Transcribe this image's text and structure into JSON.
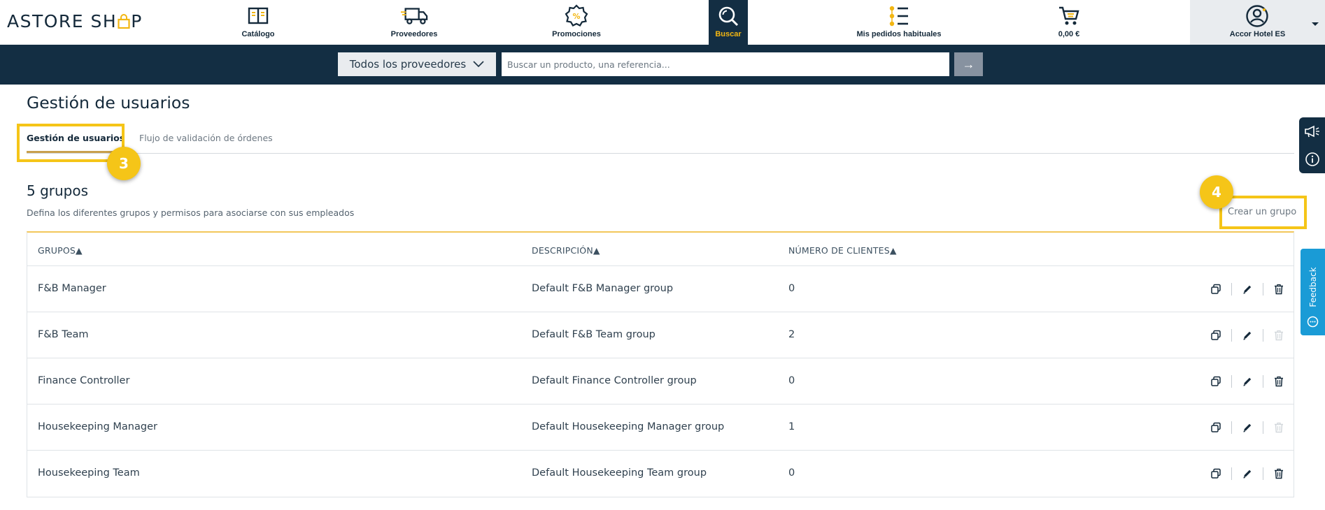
{
  "header": {
    "logo_left": "ASTORE SH",
    "logo_right": "P",
    "nav": [
      {
        "label": "Catálogo",
        "icon": "book-icon"
      },
      {
        "label": "Proveedores",
        "icon": "truck-icon"
      },
      {
        "label": "Promociones",
        "icon": "percent-badge-icon"
      },
      {
        "label": "Buscar",
        "icon": "search-icon"
      },
      {
        "label": "Mis pedidos habituales",
        "icon": "list-icon"
      },
      {
        "label": "0,00 €",
        "icon": "cart-icon"
      }
    ],
    "account_label": "Accor Hotel ES"
  },
  "search": {
    "supplier_label": "Todos los proveedores",
    "placeholder": "Buscar un producto, una referencia...",
    "go_symbol": "→"
  },
  "page": {
    "title": "Gestión de usuarios",
    "tabs": [
      "Gestión de usuarios",
      "Flujo de validación de órdenes"
    ],
    "groups_count": "5 grupos",
    "groups_description": "Defina los diferentes grupos y permisos para asociarse con sus empleados",
    "create_group_label": "Crear un grupo"
  },
  "annotations": {
    "badge_3": "3",
    "badge_4": "4"
  },
  "table": {
    "sort_indicator": "▲",
    "headers": [
      "GRUPOS",
      "DESCRIPCIÓN",
      "NÚMERO DE CLIENTES"
    ],
    "rows": [
      {
        "group": "F&B Manager",
        "description": "Default F&B Manager group",
        "clients": "0",
        "delete_enabled": true
      },
      {
        "group": "F&B Team",
        "description": "Default F&B Team group",
        "clients": "2",
        "delete_enabled": false
      },
      {
        "group": "Finance Controller",
        "description": "Default Finance Controller group",
        "clients": "0",
        "delete_enabled": true
      },
      {
        "group": "Housekeeping Manager",
        "description": "Default Housekeeping Manager group",
        "clients": "1",
        "delete_enabled": false
      },
      {
        "group": "Housekeeping Team",
        "description": "Default Housekeeping Team group",
        "clients": "0",
        "delete_enabled": true
      }
    ]
  },
  "feedback_label": "Feedback",
  "colors": {
    "navy": "#132e43",
    "accent": "#f2b612",
    "highlight": "#f5c518",
    "feedback": "#1a9bd6"
  }
}
